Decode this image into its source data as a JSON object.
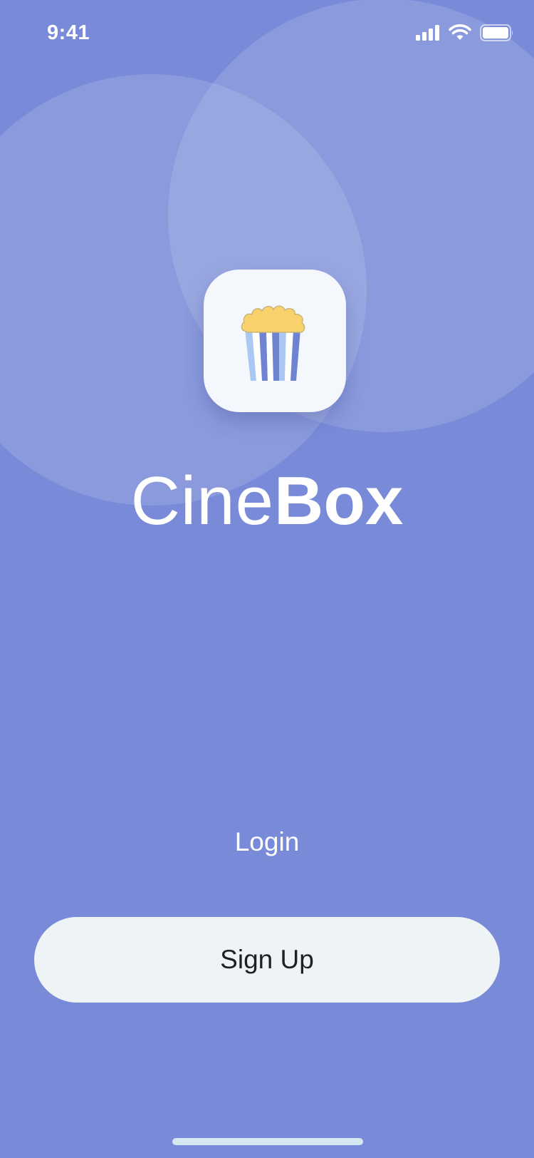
{
  "status_bar": {
    "time": "9:41",
    "icons": [
      "signal-icon",
      "wifi-icon",
      "battery-icon"
    ]
  },
  "logo": {
    "icon": "popcorn-icon",
    "colors": {
      "popcorn": "#f9d26c",
      "stripe_light": "#a9c8f3",
      "stripe_dark": "#6f83d3",
      "background": "#f4f8fc"
    }
  },
  "app_name": {
    "light": "Cine",
    "bold": "Box"
  },
  "actions": {
    "login_label": "Login",
    "signup_label": "Sign Up"
  },
  "theme": {
    "background": "#798bd8",
    "button_background": "#eef3f6",
    "home_indicator": "#d6e8f2"
  }
}
